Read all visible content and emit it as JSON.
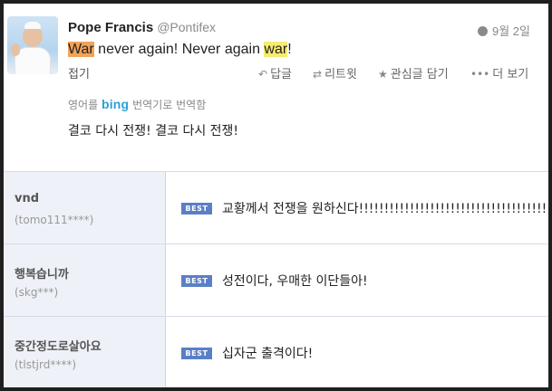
{
  "tweet": {
    "user_name": "Pope Francis",
    "handle": "@Pontifex",
    "date": "9월 2일",
    "text_parts": {
      "w1": "War",
      "middle": " never again! Never again ",
      "w2": "war",
      "end": "!"
    },
    "actions": {
      "fold": "접기",
      "reply": "답글",
      "retweet": "리트윗",
      "favorite": "관심글 담기",
      "more": "더 보기"
    },
    "translation": {
      "prefix": "영어를",
      "brand": "bing",
      "suffix": "번역기로 번역함",
      "text": "결코 다시 전쟁! 결코 다시 전쟁!"
    }
  },
  "comments": [
    {
      "name": "vnd",
      "id": "(tomo111****)",
      "badge": "BEST",
      "text": "교황께서 전쟁을 원하신다!!!!!!!!!!!!!!!!!!!!!!!!!!!!!!!!!!!!!!!!!!"
    },
    {
      "name": "행복습니까",
      "id": "(skg***)",
      "badge": "BEST",
      "text": "성전이다, 우매한 이단들아!"
    },
    {
      "name": "중간정도로살아요",
      "id": "(tlstjrd****)",
      "badge": "BEST",
      "text": "십자군 출격이다!"
    }
  ],
  "icons": {
    "globe": "globe-icon",
    "reply": "reply-arrow-icon",
    "retweet": "retweet-icon",
    "favorite": "star-icon",
    "more": "dots-icon"
  },
  "colors": {
    "highlight_1": "#f2a35a",
    "highlight_2": "#f6ec70",
    "best_badge": "#5b7fc7",
    "bing": "#2b9fd6",
    "comment_sidebar": "#eef1f7"
  }
}
